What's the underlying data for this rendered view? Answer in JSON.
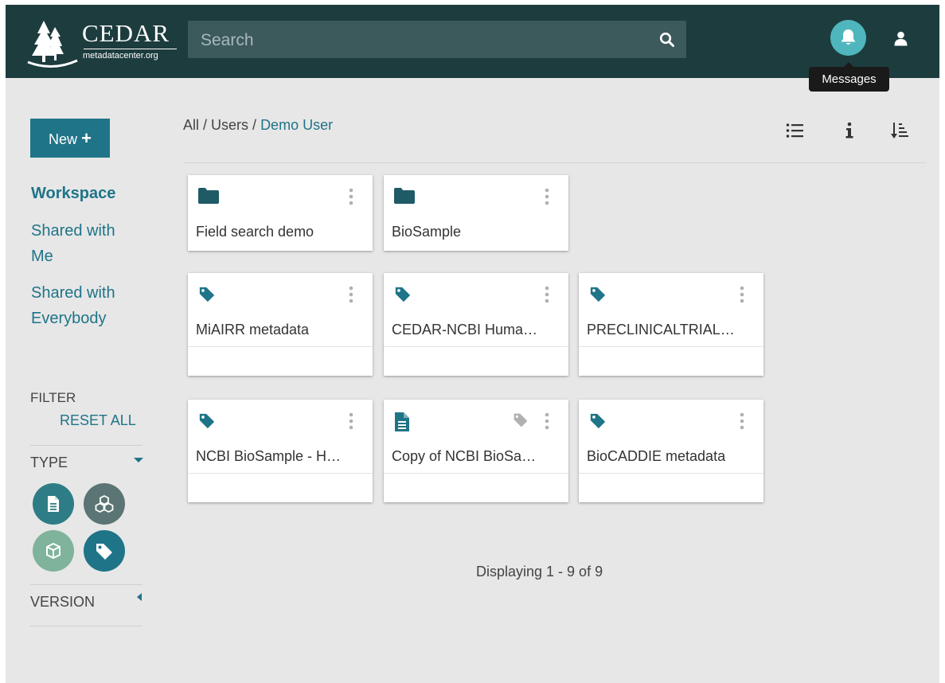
{
  "header": {
    "logo_title": "CEDAR",
    "logo_subtitle": "metadatacenter.org",
    "search_placeholder": "Search",
    "tooltip": "Messages"
  },
  "sidebar": {
    "new_button": "New",
    "nav": [
      "Workspace",
      "Shared with Me",
      "Shared with Everybody"
    ],
    "filter_label": "FILTER",
    "reset_all": "RESET ALL",
    "type_label": "TYPE",
    "version_label": "VERSION"
  },
  "breadcrumb": {
    "root": "All",
    "sep1": " / ",
    "users": "Users",
    "sep2": " / ",
    "current": "Demo User"
  },
  "cards": [
    {
      "kind": "folder-icon",
      "title": "Field search demo"
    },
    {
      "kind": "folder-icon",
      "title": "BioSample"
    },
    {
      "kind": "tag-icon",
      "title": "MiAIRR metadata"
    },
    {
      "kind": "tag-icon",
      "title": "CEDAR-NCBI Huma…"
    },
    {
      "kind": "tag-icon",
      "title": "PRECLINICALTRIAL…"
    },
    {
      "kind": "tag-icon",
      "title": "NCBI BioSample - H…"
    },
    {
      "kind": "document-icon",
      "title": "Copy of NCBI BioSa…"
    },
    {
      "kind": "tag-icon",
      "title": "BioCADDIE metadata"
    }
  ],
  "pager": "Displaying 1 - 9 of 9",
  "colors": {
    "header": "#1d3c3e",
    "accent": "#1f7488",
    "bell": "#4fb6bd",
    "instance_filter": "#2e7d86",
    "element_filter": "#5b7474",
    "field_filter": "#7fb39b",
    "template_filter": "#1f7488"
  }
}
